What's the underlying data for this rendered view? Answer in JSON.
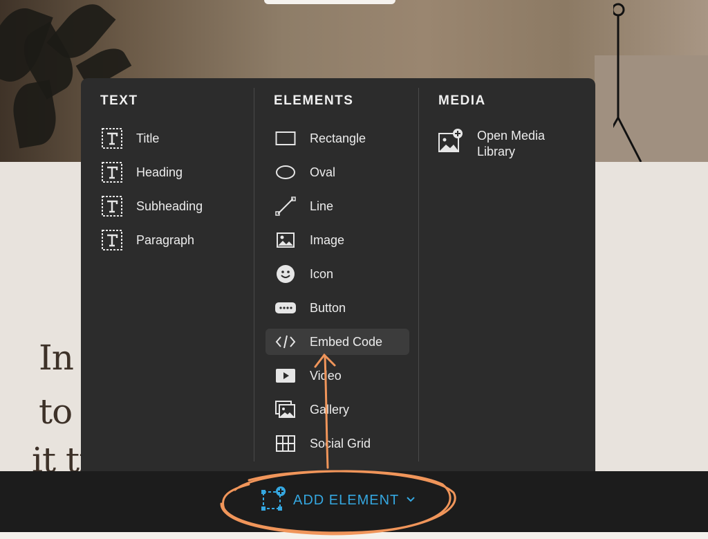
{
  "background": {
    "text_lines": [
      "In a",
      "to w",
      "it tr"
    ]
  },
  "panel": {
    "text_column": {
      "heading": "TEXT",
      "items": [
        {
          "label": "Title",
          "icon": "text-box-icon"
        },
        {
          "label": "Heading",
          "icon": "text-box-icon"
        },
        {
          "label": "Subheading",
          "icon": "text-box-icon"
        },
        {
          "label": "Paragraph",
          "icon": "text-box-icon"
        }
      ]
    },
    "elements_column": {
      "heading": "ELEMENTS",
      "items": [
        {
          "label": "Rectangle",
          "icon": "rectangle-icon"
        },
        {
          "label": "Oval",
          "icon": "oval-icon"
        },
        {
          "label": "Line",
          "icon": "line-icon"
        },
        {
          "label": "Image",
          "icon": "image-icon"
        },
        {
          "label": "Icon",
          "icon": "smiley-icon"
        },
        {
          "label": "Button",
          "icon": "button-icon"
        },
        {
          "label": "Embed Code",
          "icon": "code-icon",
          "highlighted": true
        },
        {
          "label": "Video",
          "icon": "video-icon"
        },
        {
          "label": "Gallery",
          "icon": "gallery-icon"
        },
        {
          "label": "Social Grid",
          "icon": "grid-icon"
        }
      ]
    },
    "media_column": {
      "heading": "MEDIA",
      "items": [
        {
          "label": "Open Media Library",
          "icon": "media-library-icon"
        }
      ]
    }
  },
  "bottom_bar": {
    "add_element_label": "ADD ELEMENT",
    "accent_color": "#35a7e0"
  },
  "annotation": {
    "color": "#f0955a"
  }
}
